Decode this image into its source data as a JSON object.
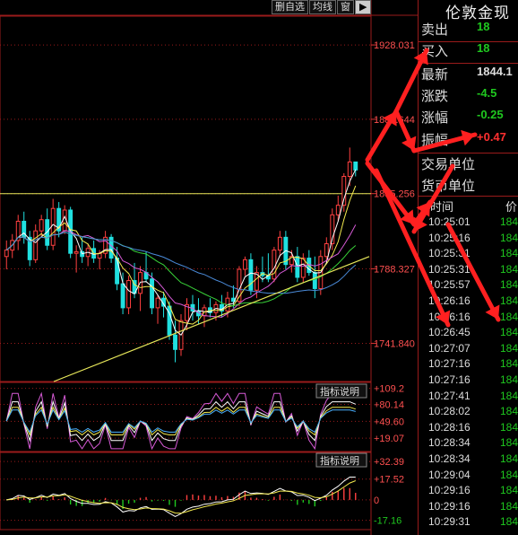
{
  "toolbar": {
    "buttons": [
      "删自选",
      "均线",
      "窗"
    ],
    "pin": "▶"
  },
  "chart_data": [
    {
      "type": "candlestick",
      "title": "",
      "y_ticks": [
        "1928.031",
        "1881.644",
        "1835.256",
        "1788.327",
        "1741.840"
      ],
      "y_values": [
        1928.031,
        1881.644,
        1835.256,
        1788.327,
        1741.84
      ],
      "ylim": [
        1718,
        1946
      ],
      "reference_price": 1835.256,
      "candles": [
        [
          1796,
          1806,
          1788,
          1800
        ],
        [
          1800,
          1810,
          1795,
          1806
        ],
        [
          1806,
          1822,
          1800,
          1818
        ],
        [
          1818,
          1824,
          1804,
          1808
        ],
        [
          1808,
          1812,
          1790,
          1794
        ],
        [
          1794,
          1816,
          1792,
          1812
        ],
        [
          1812,
          1822,
          1808,
          1819
        ],
        [
          1819,
          1826,
          1800,
          1803
        ],
        [
          1803,
          1832,
          1800,
          1826
        ],
        [
          1826,
          1830,
          1808,
          1812
        ],
        [
          1812,
          1828,
          1810,
          1825
        ],
        [
          1825,
          1827,
          1795,
          1798
        ],
        [
          1798,
          1803,
          1786,
          1799
        ],
        [
          1799,
          1808,
          1792,
          1796
        ],
        [
          1796,
          1804,
          1790,
          1801
        ],
        [
          1801,
          1806,
          1792,
          1795
        ],
        [
          1795,
          1800,
          1788,
          1798
        ],
        [
          1798,
          1812,
          1795,
          1808
        ],
        [
          1808,
          1810,
          1792,
          1795
        ],
        [
          1795,
          1802,
          1775,
          1779
        ],
        [
          1779,
          1786,
          1760,
          1764
        ],
        [
          1764,
          1784,
          1760,
          1781
        ],
        [
          1781,
          1792,
          1770,
          1773
        ],
        [
          1773,
          1790,
          1762,
          1786
        ],
        [
          1786,
          1799,
          1780,
          1782
        ],
        [
          1782,
          1786,
          1760,
          1764
        ],
        [
          1764,
          1772,
          1754,
          1770
        ],
        [
          1770,
          1774,
          1758,
          1765
        ],
        [
          1765,
          1768,
          1744,
          1747
        ],
        [
          1747,
          1756,
          1730,
          1738
        ],
        [
          1738,
          1760,
          1734,
          1756
        ],
        [
          1756,
          1770,
          1750,
          1766
        ],
        [
          1766,
          1772,
          1756,
          1762
        ],
        [
          1762,
          1770,
          1754,
          1759
        ],
        [
          1759,
          1766,
          1752,
          1764
        ],
        [
          1764,
          1770,
          1758,
          1761
        ],
        [
          1761,
          1768,
          1756,
          1766
        ],
        [
          1766,
          1772,
          1758,
          1762
        ],
        [
          1762,
          1774,
          1758,
          1770
        ],
        [
          1770,
          1778,
          1764,
          1768
        ],
        [
          1768,
          1790,
          1765,
          1788
        ],
        [
          1788,
          1796,
          1784,
          1794
        ],
        [
          1794,
          1798,
          1772,
          1775
        ],
        [
          1775,
          1790,
          1770,
          1786
        ],
        [
          1786,
          1796,
          1780,
          1784
        ],
        [
          1784,
          1798,
          1780,
          1782
        ],
        [
          1782,
          1802,
          1780,
          1800
        ],
        [
          1800,
          1812,
          1796,
          1808
        ],
        [
          1808,
          1812,
          1788,
          1791
        ],
        [
          1791,
          1800,
          1786,
          1796
        ],
        [
          1796,
          1802,
          1780,
          1783
        ],
        [
          1783,
          1798,
          1780,
          1795
        ],
        [
          1795,
          1800,
          1784,
          1786
        ],
        [
          1786,
          1796,
          1770,
          1776
        ],
        [
          1776,
          1800,
          1772,
          1796
        ],
        [
          1796,
          1808,
          1792,
          1804
        ],
        [
          1804,
          1826,
          1800,
          1822
        ],
        [
          1822,
          1834,
          1818,
          1828
        ],
        [
          1828,
          1848,
          1824,
          1846
        ],
        [
          1846,
          1864,
          1840,
          1855
        ],
        [
          1855,
          1852,
          1846,
          1850
        ]
      ],
      "ma_colors": [
        "#ffffff",
        "#f2e94e",
        "#d65ad6",
        "#39d339",
        "#4a8ad8"
      ]
    },
    {
      "type": "line",
      "title": "",
      "button": "指标说明",
      "y_ticks": [
        "+109.2",
        "+80.14",
        "+49.60",
        "+19.07"
      ],
      "ylim": [
        -5,
        120
      ]
    },
    {
      "type": "bar",
      "title": "",
      "button": "指标说明",
      "y_ticks": [
        "+32.39",
        "+17.52",
        "0",
        "-17.16"
      ],
      "ylim": [
        -25,
        40
      ]
    }
  ],
  "quote": {
    "title": "伦敦金现",
    "rows": [
      {
        "label": "卖出",
        "value": "18",
        "color": "#1fc81f"
      },
      {
        "label": "买入",
        "value": "18",
        "color": "#1fc81f"
      },
      {
        "label": "最新",
        "value": "1844.1",
        "color": "#dddddd"
      },
      {
        "label": "涨跌",
        "value": "-4.5",
        "color": "#1fc81f"
      },
      {
        "label": "涨幅",
        "value": "-0.25",
        "color": "#1fc81f"
      },
      {
        "label": "振幅",
        "value": "+0.47",
        "color": "#ff3030"
      },
      {
        "label": "交易单位",
        "value": "",
        "color": "#dddddd"
      },
      {
        "label": "货币单位",
        "value": "",
        "color": "#dddddd"
      }
    ]
  },
  "ticks": {
    "header_time": "时间",
    "header_price": "价",
    "rows": [
      {
        "time": "10:25:01",
        "price": "184"
      },
      {
        "time": "10:25:16",
        "price": "184"
      },
      {
        "time": "10:25:31",
        "price": "184"
      },
      {
        "time": "10:25:31",
        "price": "184"
      },
      {
        "time": "10:25:57",
        "price": "184"
      },
      {
        "time": "10:26:16",
        "price": "184"
      },
      {
        "time": "10:26:16",
        "price": "184"
      },
      {
        "time": "10:26:45",
        "price": "184"
      },
      {
        "time": "10:27:07",
        "price": "184"
      },
      {
        "time": "10:27:16",
        "price": "184"
      },
      {
        "time": "10:27:16",
        "price": "184"
      },
      {
        "time": "10:27:41",
        "price": "184"
      },
      {
        "time": "10:28:02",
        "price": "184"
      },
      {
        "time": "10:28:16",
        "price": "184"
      },
      {
        "time": "10:28:34",
        "price": "184"
      },
      {
        "time": "10:28:34",
        "price": "184"
      },
      {
        "time": "10:29:04",
        "price": "184"
      },
      {
        "time": "10:29:16",
        "price": "184"
      },
      {
        "time": "10:29:16",
        "price": "184"
      },
      {
        "time": "10:29:31",
        "price": "184"
      }
    ]
  },
  "colors": {
    "up": "#ff4040",
    "down": "#20e0e0",
    "frame": "#9a1b1b",
    "ref_line": "#e8e85a",
    "arrow": "#ff2020"
  }
}
